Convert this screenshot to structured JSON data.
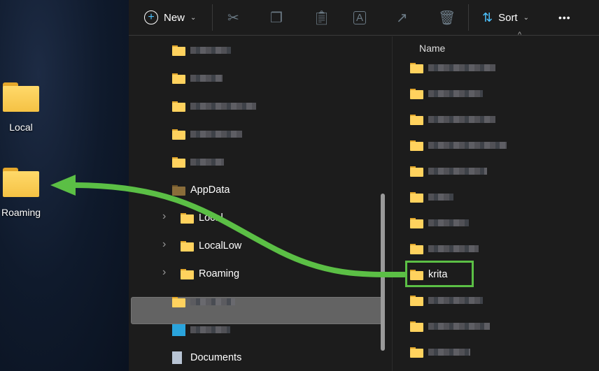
{
  "desktop": {
    "icons": [
      {
        "label": "Local"
      },
      {
        "label": "Roaming"
      }
    ]
  },
  "toolbar": {
    "new_label": "New",
    "sort_label": "Sort",
    "more": "•••",
    "icons": [
      "plus-circle-icon",
      "cut-icon",
      "copy-icon",
      "paste-icon",
      "rename-icon",
      "share-icon",
      "delete-icon",
      "sort-icon"
    ]
  },
  "nav": {
    "appdata": "AppData",
    "local": "Local",
    "locallow": "LocalLow",
    "roaming": "Roaming",
    "documents": "Documents"
  },
  "list": {
    "header": "Name",
    "highlighted": "krita"
  },
  "colors": {
    "annotation": "#5bbf45",
    "folder": "#ffd25e"
  }
}
